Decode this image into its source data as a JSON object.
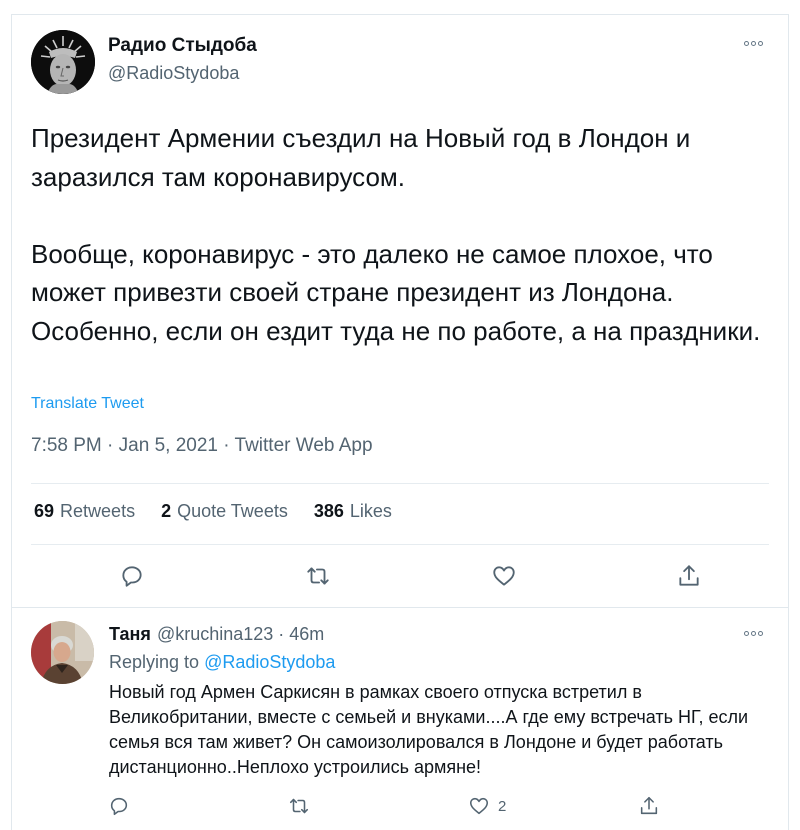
{
  "tweet": {
    "display_name": "Радио Стыдоба",
    "handle": "@RadioStydoba",
    "avatar": "statue-of-liberty-face-avatar",
    "paragraphs": [
      "Президент Армении съездил на Новый год в Лондон и заразился там коронавирусом.",
      "Вообще, коронавирус - это далеко не самое плохое, что может привезти своей стране президент из Лондона. Особенно, если он ездит туда не по работе, а на праздники."
    ],
    "translate_label": "Translate Tweet",
    "time": "7:58 PM",
    "date": "Jan 5, 2021",
    "source": "Twitter Web App",
    "stats": {
      "retweets_count": "69",
      "retweets_label": "Retweets",
      "quotes_count": "2",
      "quotes_label": "Quote Tweets",
      "likes_count": "386",
      "likes_label": "Likes"
    },
    "icons": [
      "reply-icon",
      "retweet-icon",
      "like-icon",
      "share-icon",
      "more-icon"
    ]
  },
  "reply": {
    "display_name": "Таня",
    "handle": "@kruchina123",
    "time": "46m",
    "replying_prefix": "Replying to",
    "replying_to": "@RadioStydoba",
    "text": "Новый год Армен Саркисян в рамках своего отпуска встретил в Великобритании, вместе с семьей и внуками....А где ему встречать НГ, если семья вся там живет? Он самоизолировался в Лондоне и будет работать дистанционно..Неплохо устроились армяне!",
    "like_count": "2"
  },
  "colors": {
    "accent": "#1d9bf0",
    "secondary_text": "#536471",
    "primary_text": "#0f1419",
    "border": "#e1e8ed"
  }
}
